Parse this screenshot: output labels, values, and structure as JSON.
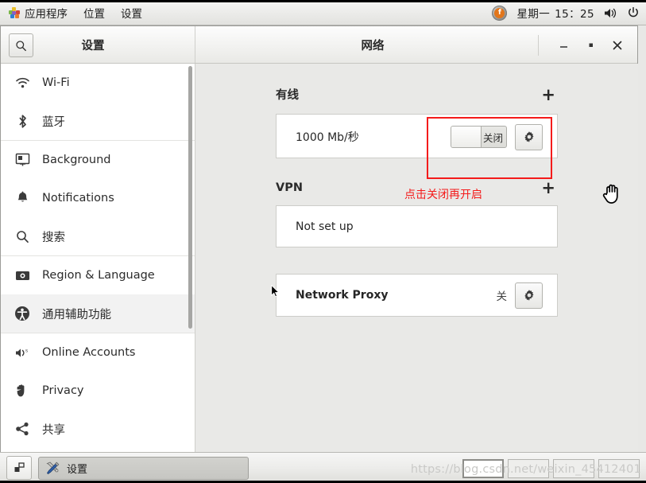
{
  "top_panel": {
    "menus": [
      "应用程序",
      "位置",
      "设置"
    ],
    "apps_icon": "applications-icon",
    "fedora_icon": "fedora-logo-icon",
    "clock": {
      "weekday": "星期一",
      "time": "15：25"
    },
    "volume_icon": "volume-icon",
    "power_icon": "power-icon"
  },
  "window": {
    "sidebar_title": "设置",
    "title": "网络",
    "search_icon": "search-icon",
    "minimize_label": "—",
    "maximize_label": "▫",
    "close_label": "✕"
  },
  "sidebar": {
    "items": [
      {
        "label": "Wi-Fi",
        "icon": "wifi-icon",
        "selected": false
      },
      {
        "label": "蓝牙",
        "icon": "bluetooth-icon",
        "selected": false
      },
      {
        "label": "Background",
        "icon": "background-icon",
        "selected": false
      },
      {
        "label": "Notifications",
        "icon": "bell-icon",
        "selected": false
      },
      {
        "label": "搜索",
        "icon": "search-icon",
        "selected": false
      },
      {
        "label": "Region & Language",
        "icon": "region-language-icon",
        "selected": false
      },
      {
        "label": "通用辅助功能",
        "icon": "accessibility-icon",
        "selected": true
      },
      {
        "label": "Online Accounts",
        "icon": "online-accounts-icon",
        "selected": false
      },
      {
        "label": "Privacy",
        "icon": "privacy-hand-icon",
        "selected": false
      },
      {
        "label": "共享",
        "icon": "sharing-icon",
        "selected": false
      }
    ]
  },
  "content": {
    "wired": {
      "heading": "有线",
      "add_label": "+",
      "speed": "1000 Mb/秒",
      "toggle_label": "关闭",
      "toggle_state": "off",
      "gear_icon": "gear-icon"
    },
    "vpn": {
      "heading": "VPN",
      "add_label": "+",
      "status": "Not set up"
    },
    "proxy": {
      "label": "Network Proxy",
      "status": "关",
      "gear_icon": "gear-icon"
    },
    "annotation": {
      "text": "点击关闭再开启",
      "color": "#f41b1b"
    }
  },
  "bottom_panel": {
    "show_desktop_icon": "show-desktop-icon",
    "task_label": "设置",
    "task_icon": "tools-icon",
    "workspace_count": 4,
    "active_workspace": 1,
    "watermark": "https://blog.csdn.net/weixin_45412401"
  }
}
